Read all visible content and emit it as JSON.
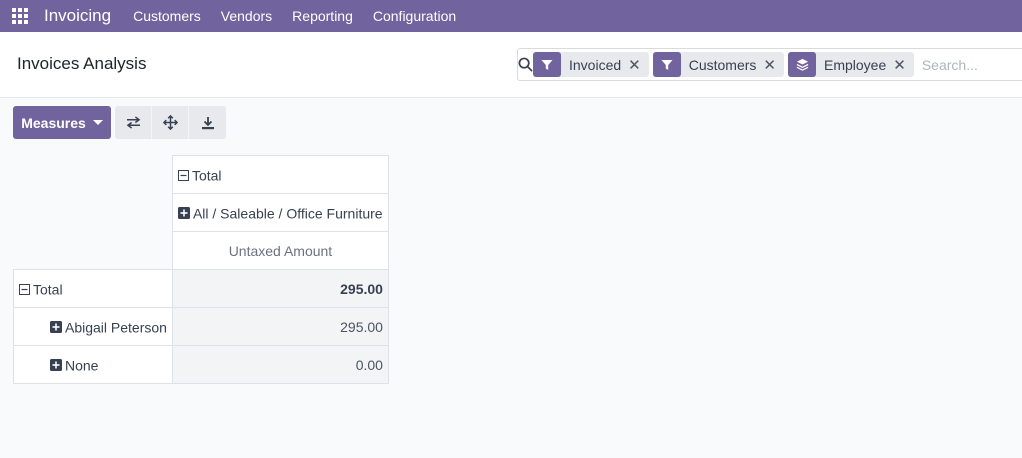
{
  "navbar": {
    "brand": "Invoicing",
    "menu": [
      "Customers",
      "Vendors",
      "Reporting",
      "Configuration"
    ]
  },
  "page": {
    "title": "Invoices Analysis"
  },
  "search": {
    "placeholder": "Search...",
    "facets": [
      {
        "label": "Invoiced",
        "icon": "filter-icon"
      },
      {
        "label": "Customers",
        "icon": "filter-icon"
      },
      {
        "label": "Employee",
        "icon": "group-by-icon"
      }
    ]
  },
  "toolbar": {
    "measures_label": "Measures",
    "tools": [
      "flip-axis-icon",
      "expand-all-icon",
      "download-icon"
    ]
  },
  "pivot": {
    "col_total_label": "Total",
    "col_group_label": "All / Saleable / Office Furniture",
    "measure_label": "Untaxed Amount",
    "rows": [
      {
        "label": "Total",
        "value": "295.00"
      },
      {
        "label": "Abigail Peterson",
        "value": "295.00"
      },
      {
        "label": "None",
        "value": "0.00"
      }
    ]
  },
  "colors": {
    "brand": "#71639e",
    "cell_bg": "#f3f4f6",
    "border": "#dee2e6"
  }
}
